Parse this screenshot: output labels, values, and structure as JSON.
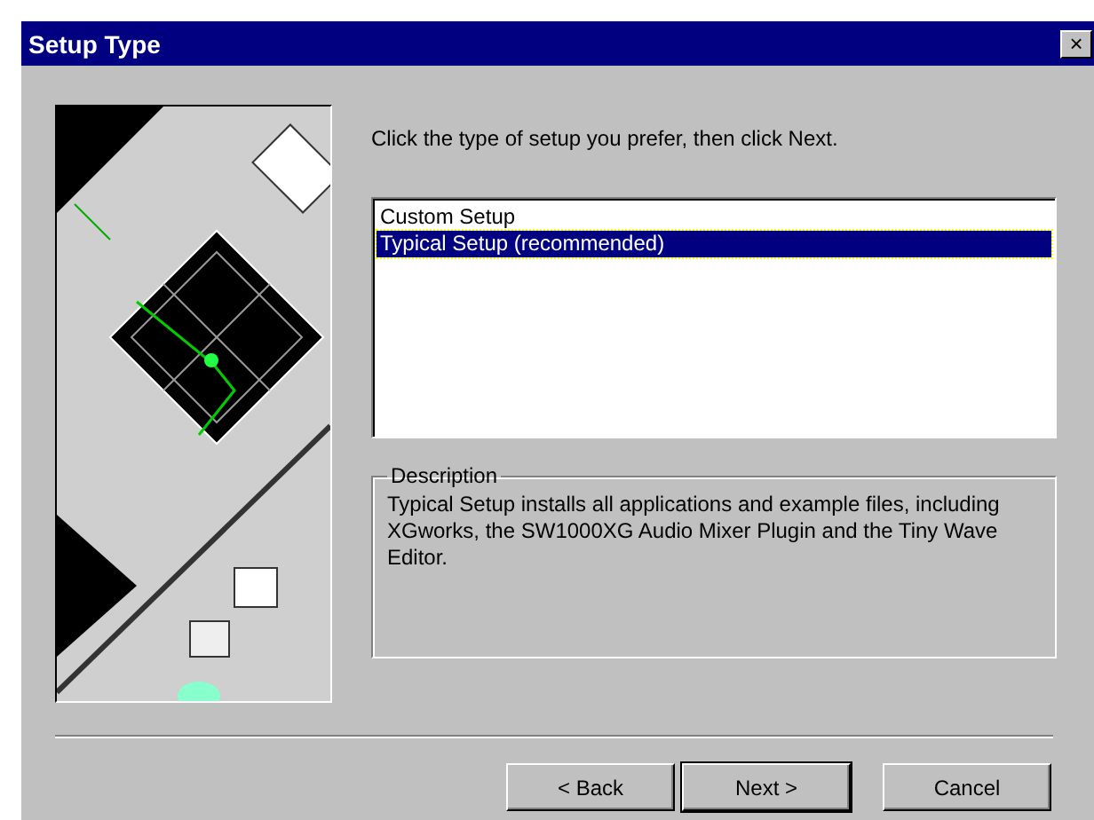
{
  "window": {
    "title": "Setup Type",
    "close": "×"
  },
  "instruction": "Click the type of setup you prefer, then click Next.",
  "setup_types": [
    {
      "label": "Custom Setup",
      "selected": false
    },
    {
      "label": "Typical Setup (recommended)",
      "selected": true
    }
  ],
  "description": {
    "title": "Description",
    "text": "Typical Setup installs all applications and example files, including XGworks, the SW1000XG Audio Mixer Plugin and the Tiny Wave Editor."
  },
  "buttons": [
    "< Back",
    "Next >",
    "Cancel"
  ]
}
